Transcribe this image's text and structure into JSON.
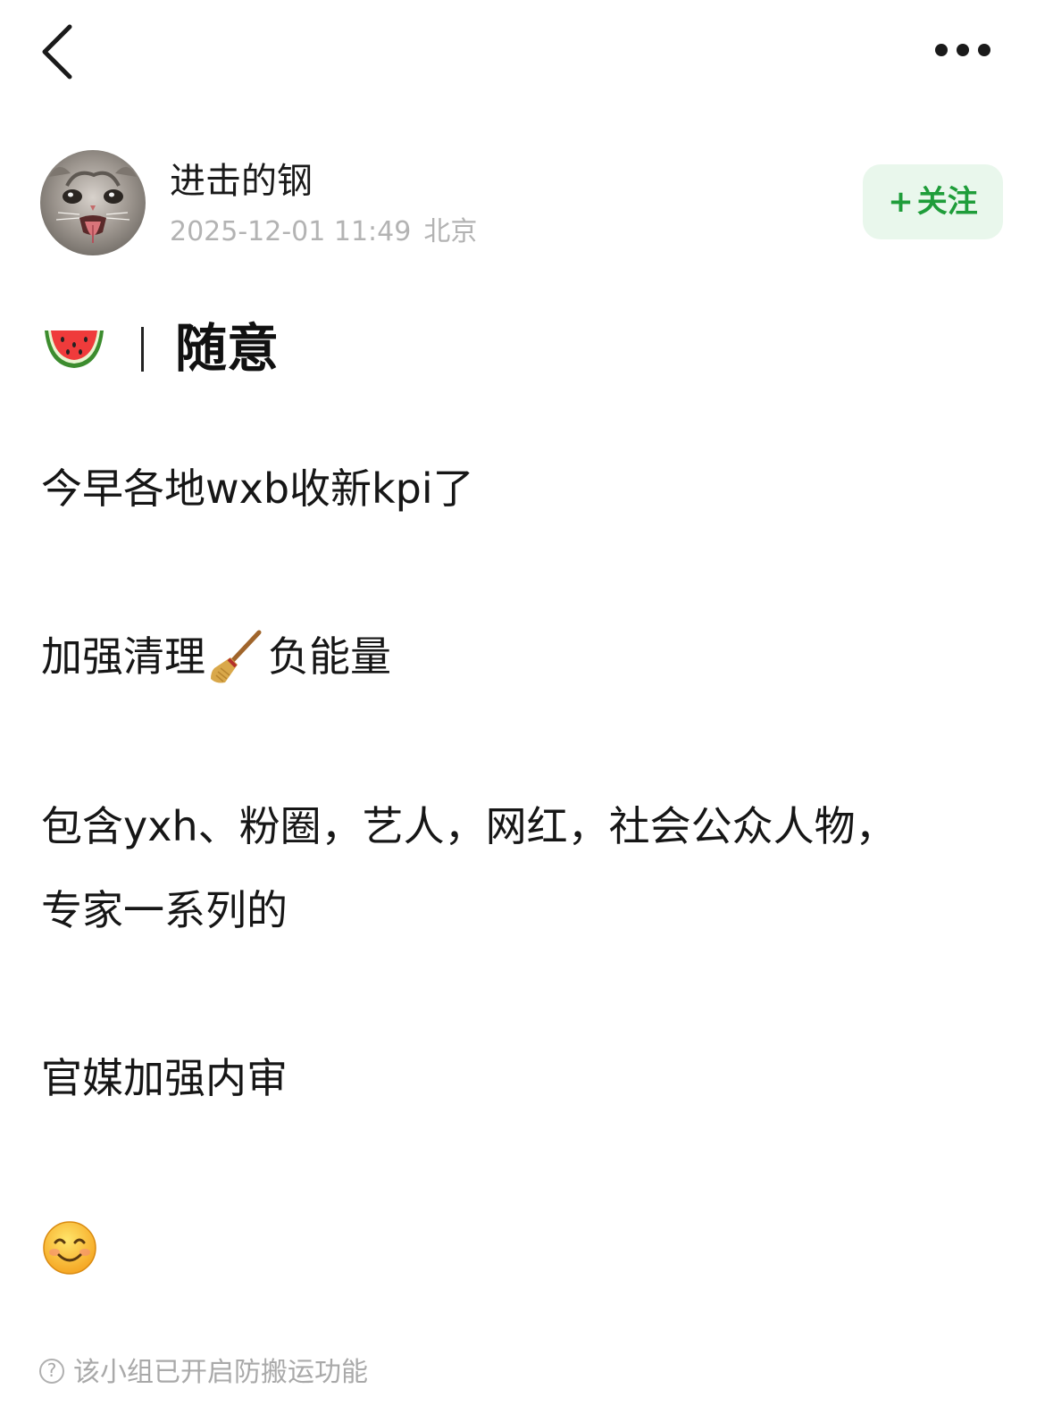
{
  "topbar": {
    "back_icon": "chevron-left-icon",
    "more_icon": "more-horizontal-icon"
  },
  "author": {
    "name": "进击的钢",
    "datetime": "2025-12-01 11:49",
    "location": "北京",
    "avatar_icon": "cat-avatar",
    "follow_plus": "+",
    "follow_label": "关注"
  },
  "group": {
    "icon": "watermelon-icon",
    "name": "随意"
  },
  "post": {
    "line1": "今早各地wxb收新kpi了",
    "line2_a": "加强清理",
    "line2_icon": "broom-icon",
    "line2_b": "负能量",
    "line3": "包含yxh、粉圈，艺人，网红，社会公众人物，",
    "line4": "专家一系列的",
    "line5": "官媒加强内审",
    "closing_icon": "smiling-face-icon"
  },
  "footer": {
    "note_icon": "question-circle-icon",
    "note": "该小组已开启防搬运功能"
  },
  "colors": {
    "accent_green": "#1f9d3a",
    "follow_bg": "#e9f7ec",
    "meta_gray": "#b3b3b3"
  }
}
